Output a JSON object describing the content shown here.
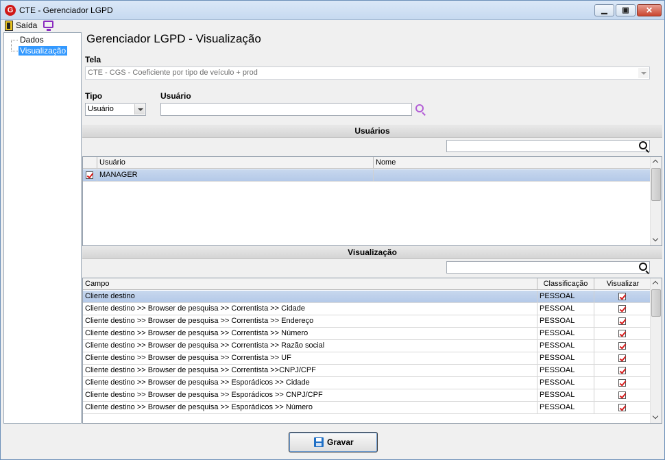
{
  "window": {
    "title": "CTE - Gerenciador LGPD",
    "app_icon_letter": "G",
    "minimize_glyph": "▁",
    "maximize_glyph": "▣",
    "close_glyph": "✕"
  },
  "menu": {
    "exit_label": "Saída"
  },
  "tree": {
    "items": [
      {
        "label": "Dados"
      },
      {
        "label": "Visualização"
      }
    ]
  },
  "page": {
    "title": "Gerenciador LGPD - Visualização"
  },
  "form": {
    "tela_label": "Tela",
    "tela_value": "CTE - CGS - Coeficiente por tipo de veículo + prod",
    "tipo_label": "Tipo",
    "tipo_value": "Usuário",
    "usuario_label": "Usuário",
    "usuario_value": ""
  },
  "users_section": {
    "title": "Usuários",
    "search_value": "",
    "columns": [
      "Usuário",
      "Nome"
    ],
    "rows": [
      {
        "usuario": "MANAGER",
        "nome": "",
        "checked": true
      }
    ]
  },
  "view_section": {
    "title": "Visualização",
    "search_value": "",
    "columns": [
      "Campo",
      "Classificação",
      "Visualizar"
    ],
    "rows": [
      {
        "campo": "Cliente destino",
        "classificacao": "PESSOAL",
        "visualizar": true
      },
      {
        "campo": "Cliente destino >> Browser de pesquisa >> Correntista >> Cidade",
        "classificacao": "PESSOAL",
        "visualizar": true
      },
      {
        "campo": "Cliente destino >> Browser de pesquisa >> Correntista >> Endereço",
        "classificacao": "PESSOAL",
        "visualizar": true
      },
      {
        "campo": "Cliente destino >> Browser de pesquisa >> Correntista >> Número",
        "classificacao": "PESSOAL",
        "visualizar": true
      },
      {
        "campo": "Cliente destino >> Browser de pesquisa >> Correntista >> Razão social",
        "classificacao": "PESSOAL",
        "visualizar": true
      },
      {
        "campo": "Cliente destino >> Browser de pesquisa >> Correntista >> UF",
        "classificacao": "PESSOAL",
        "visualizar": true
      },
      {
        "campo": "Cliente destino >> Browser de pesquisa >> Correntista >>CNPJ/CPF",
        "classificacao": "PESSOAL",
        "visualizar": true
      },
      {
        "campo": "Cliente destino >> Browser de pesquisa >> Esporádicos >> Cidade",
        "classificacao": "PESSOAL",
        "visualizar": true
      },
      {
        "campo": "Cliente destino >> Browser de pesquisa >> Esporádicos >> CNPJ/CPF",
        "classificacao": "PESSOAL",
        "visualizar": true
      },
      {
        "campo": "Cliente destino >> Browser de pesquisa >> Esporádicos >> Número",
        "classificacao": "PESSOAL",
        "visualizar": true
      }
    ]
  },
  "footer": {
    "save_label": "Gravar"
  },
  "colors": {
    "selection": "#3399ff",
    "row_selected": "#c8d8ee",
    "check_mark": "#d81e1e"
  }
}
